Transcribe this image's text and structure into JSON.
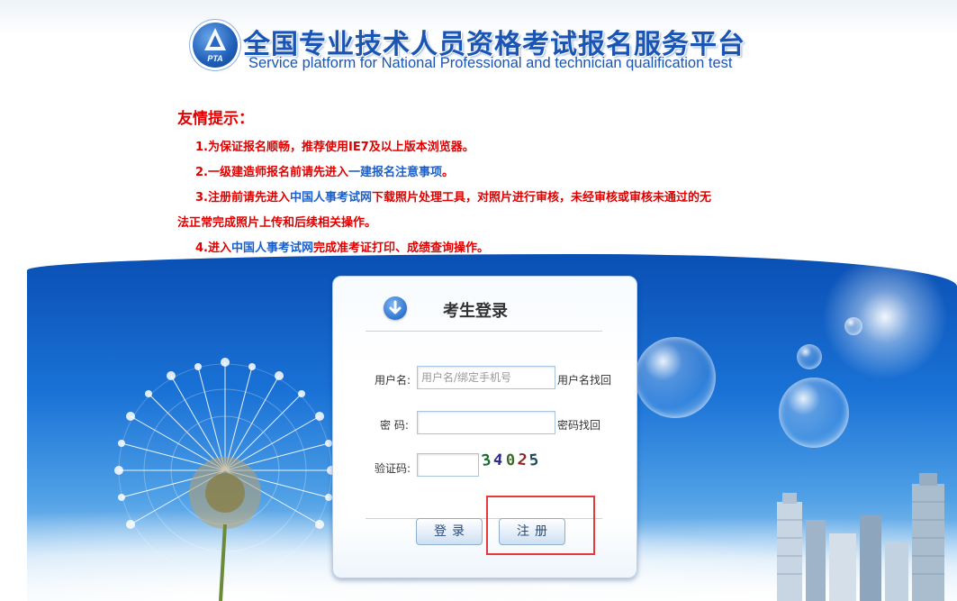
{
  "header": {
    "logo_text": "PTA",
    "title_cn": "全国专业技术人员资格考试报名服务平台",
    "title_en": "Service platform for National Professional and technician qualification test"
  },
  "notice": {
    "title": "友情提示：",
    "line1": "1.为保证报名顺畅，推荐使用IE7及以上版本浏览器。",
    "line2_a": "2.一级建造师报名前请先进入",
    "line2_link": "一建报名注意事项",
    "line2_b": "。",
    "line3_a": "3.注册前请先进入",
    "line3_link": "中国人事考试网",
    "line3_b": "下载照片处理工具，对照片进行审核，未经审核或审核未通过的无",
    "line3_cont": "法正常完成照片上传和后续相关操作。",
    "line4_a": "4.进入",
    "line4_link": "中国人事考试网",
    "line4_b": "完成准考证打印、成绩查询操作。"
  },
  "login": {
    "title": "考生登录",
    "username_label": "用户名:",
    "username_placeholder": "用户名/绑定手机号",
    "username_value": "",
    "username_recover": "用户名找回",
    "password_label": "密  码:",
    "password_value": "",
    "password_recover": "密码找回",
    "captcha_label": "验证码:",
    "captcha_value": "",
    "captcha_digits": [
      "3",
      "4",
      "0",
      "2",
      "5"
    ],
    "login_button": "登录",
    "register_button": "注册"
  },
  "colors": {
    "notice_red": "#e00000",
    "link_blue": "#1a5fcc",
    "title_blue": "#1b55b3",
    "highlight_red": "#e63a3a"
  }
}
